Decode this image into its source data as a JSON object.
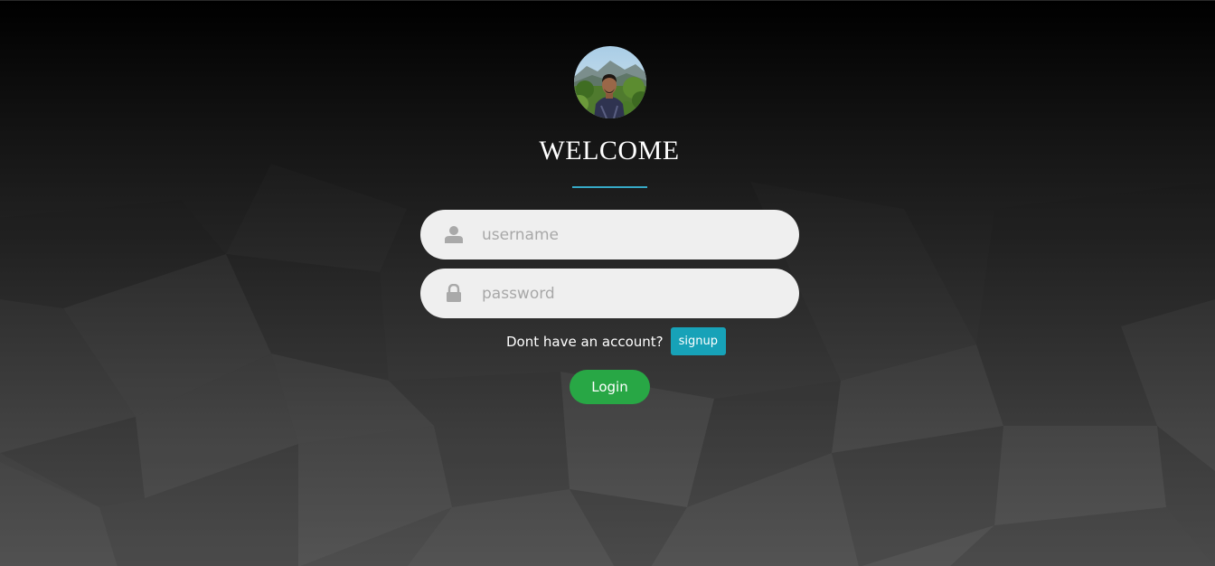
{
  "welcome": {
    "title": "WELCOME"
  },
  "avatar": {
    "icon": "profile-photo"
  },
  "form": {
    "username": {
      "placeholder": "username",
      "value": "",
      "icon": "user-icon"
    },
    "password": {
      "placeholder": "password",
      "value": "",
      "icon": "lock-icon"
    },
    "signup_prompt": "Dont have an account?",
    "signup_label": "signup",
    "login_label": "Login"
  },
  "colors": {
    "accent_underline": "#36a9c6",
    "signup_button": "#17a2b8",
    "login_button": "#28a745",
    "field_background": "#efefef",
    "placeholder": "#a8a8a8"
  }
}
